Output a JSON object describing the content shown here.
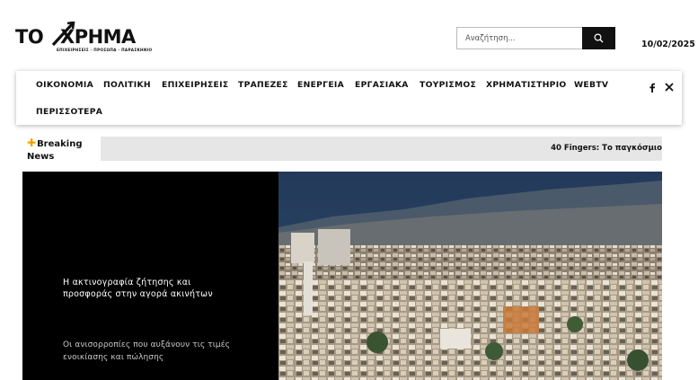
{
  "brand": {
    "logo_left": "ΤΟ",
    "logo_right": "ΧΡΗΜΑ",
    "tagline": "ΕΠΙΧΕΙΡΗΣΕΙΣ · ΠΡΟΣΩΠΑ · ΠΑΡΑΣΚΗΝΙΟ"
  },
  "search": {
    "placeholder": "Αναζήτηση...",
    "icon": "search-icon"
  },
  "date": "10/02/2025",
  "nav": {
    "items": [
      "ΟΙΚΟΝΟΜΙΑ",
      "ΠΟΛΙΤΙΚΗ",
      "ΕΠΙΧΕΙΡΗΣΕΙΣ",
      "ΤΡΑΠΕΖΕΣ",
      "ΕΝΕΡΓΕΙΑ",
      "ΕΡΓΑΣΙΑΚΑ",
      "ΤΟΥΡΙΣΜΟΣ",
      "ΧΡΗΜΑΤΙΣΤΗΡΙΟ",
      "WEBTV",
      "ΠΕΡΙΣΣΟΤΕΡΑ"
    ],
    "social": [
      "facebook-icon",
      "x-icon"
    ]
  },
  "breaking": {
    "label_line1": "Breaking",
    "label_line2": "News",
    "ticker": "40 Fingers: Το παγκόσμιο"
  },
  "hero": {
    "title": "Η ακτινογραφία ζήτησης και προσφοράς στην αγορά ακινήτων",
    "subtitle": "Οι ανισορροπίες που αυξάνουν τις τιμές ενοικίασης και πώλησης"
  },
  "colors": {
    "accent": "#f5a000",
    "dark": "#111111",
    "ticker_bg": "#e6e6e6"
  }
}
